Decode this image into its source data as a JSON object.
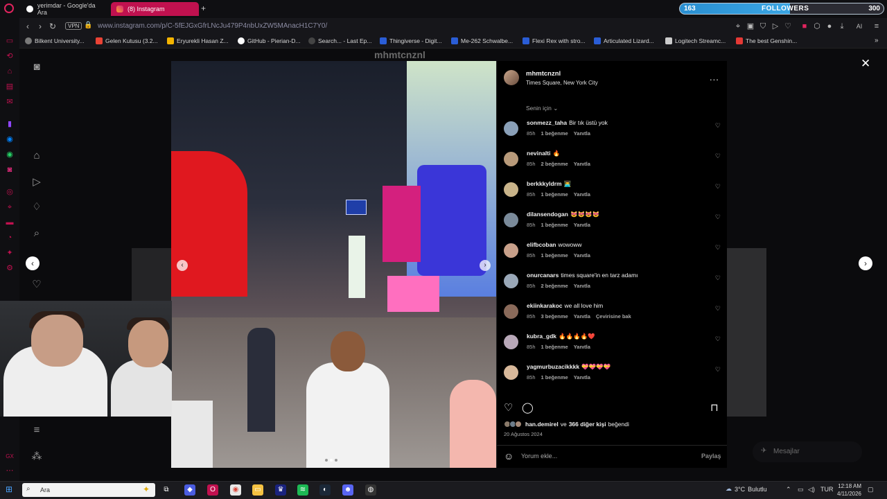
{
  "browser": {
    "tabs": [
      {
        "title": "yerimdar - Google'da Ara",
        "active": false
      },
      {
        "title": "(8) Instagram",
        "active": true
      }
    ],
    "new_tab": "+",
    "vpn_label": "VPN",
    "url": "www.instagram.com/p/C-5fEJGxGfrLNcJu479P4nbUxZW5MAnacH1C7Y0/",
    "ai_label": "AI",
    "bookmarks": [
      "Bilkent University...",
      "Gelen Kutusu (3.2...",
      "Eryurekli Hasan Z...",
      "GitHub - Pierian-D...",
      "Search... - Last Ep...",
      "Thingiverse - Digit...",
      "Me-262 Schwalbe...",
      "Flexi Rex with stro...",
      "Articulated Lizard...",
      "Logitech Streamc...",
      "The best Genshin..."
    ]
  },
  "followers_widget": {
    "count": "163",
    "label": "FOLLOWERS",
    "goal": "300",
    "progress": 0.543
  },
  "background_username": "mhmtcnznl",
  "post": {
    "username": "mhmtcnznl",
    "location": "Times Square, New York City",
    "more": "...",
    "sort_label": "Senin için",
    "comments": [
      {
        "user": "sonmezz_taha",
        "text": "Bir tık üstü yok",
        "time": "85h",
        "likes": "1 beğenme",
        "reply": "Yanıtla",
        "translate": ""
      },
      {
        "user": "nevinalti",
        "text": "🔥",
        "time": "85h",
        "likes": "2 beğenme",
        "reply": "Yanıtla",
        "translate": ""
      },
      {
        "user": "berkkkyldrm",
        "text": "👨‍💻",
        "time": "85h",
        "likes": "1 beğenme",
        "reply": "Yanıtla",
        "translate": ""
      },
      {
        "user": "dilansendogan",
        "text": "😻😻😻😻",
        "time": "85h",
        "likes": "1 beğenme",
        "reply": "Yanıtla",
        "translate": ""
      },
      {
        "user": "elifbcoban",
        "text": "wowoww",
        "time": "85h",
        "likes": "1 beğenme",
        "reply": "Yanıtla",
        "translate": ""
      },
      {
        "user": "onurcanars",
        "text": "times square'in en tarz adamı",
        "time": "85h",
        "likes": "2 beğenme",
        "reply": "Yanıtla",
        "translate": ""
      },
      {
        "user": "ekiinkarakoc",
        "text": "we all love him",
        "time": "85h",
        "likes": "3 beğenme",
        "reply": "Yanıtla",
        "translate": "Çevirisine bak"
      },
      {
        "user": "kubra_gdk",
        "text": "🔥🔥🔥🔥❤️",
        "time": "85h",
        "likes": "1 beğenme",
        "reply": "Yanıtla",
        "translate": ""
      },
      {
        "user": "yagmurbuzacikkkk",
        "text": "💝💝💝💝",
        "time": "85h",
        "likes": "1 beğenme",
        "reply": "Yanıtla",
        "translate": ""
      }
    ],
    "likes_user": "han.demirel",
    "likes_mid": "ve",
    "likes_others": "366 diğer kişi",
    "likes_suffix": "beğendi",
    "date": "20 Ağustos 2024",
    "comment_placeholder": "Yorum ekle...",
    "share_label": "Paylaş"
  },
  "messages_label": "Mesajlar",
  "taskbar": {
    "search_label": "Ara",
    "weather_temp": "3°C",
    "weather_text": "Bulutlu",
    "lang": "TUR",
    "time": "12:18 AM",
    "date": "4/11/2026"
  },
  "colors": {
    "accent": "#c0114f",
    "followers_bar": "#3aa5e3",
    "panel_bg": "#000000"
  }
}
